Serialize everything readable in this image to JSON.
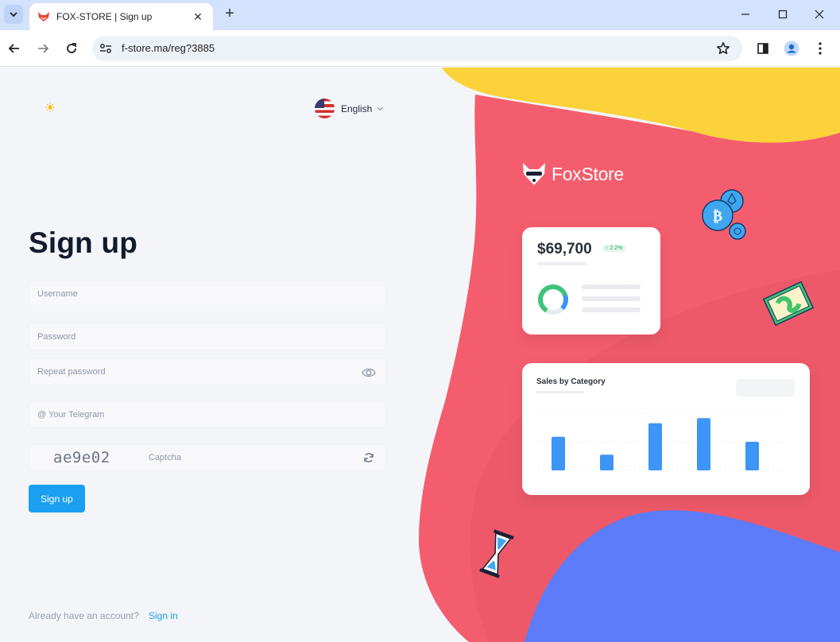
{
  "browser": {
    "tab_title": "FOX-STORE | Sign up",
    "tab_close": "✕",
    "new_tab": "+",
    "url": "f-store.ma/reg?3885"
  },
  "page": {
    "language": "English",
    "title": "Sign up",
    "fields": {
      "username_placeholder": "Username",
      "password_placeholder": "Password",
      "repeat_password_placeholder": "Repeat password",
      "telegram_placeholder": "@ Your Telegram",
      "captcha_placeholder": "Captcha",
      "captcha_code": "ae9e02"
    },
    "signup_button": "Sign up",
    "already_text": "Already have an account?",
    "signin_link": "Sign in"
  },
  "art": {
    "brand_name": "FoxStore",
    "card_amount": "$69,700",
    "card_badge": "↑ 2.2%",
    "chart_title": "Sales by Category"
  },
  "colors": {
    "accent": "#1a9ff1",
    "coral": "#f45d6d",
    "yellow": "#fcd23a",
    "blue": "#5c7cfa",
    "bar": "#3d95f7"
  },
  "chart_data": {
    "type": "bar",
    "title": "Sales by Category",
    "categories": [
      "",
      "",
      "",
      "",
      ""
    ],
    "values": [
      47,
      22,
      66,
      73,
      40
    ],
    "ylim": [
      0,
      80
    ]
  }
}
